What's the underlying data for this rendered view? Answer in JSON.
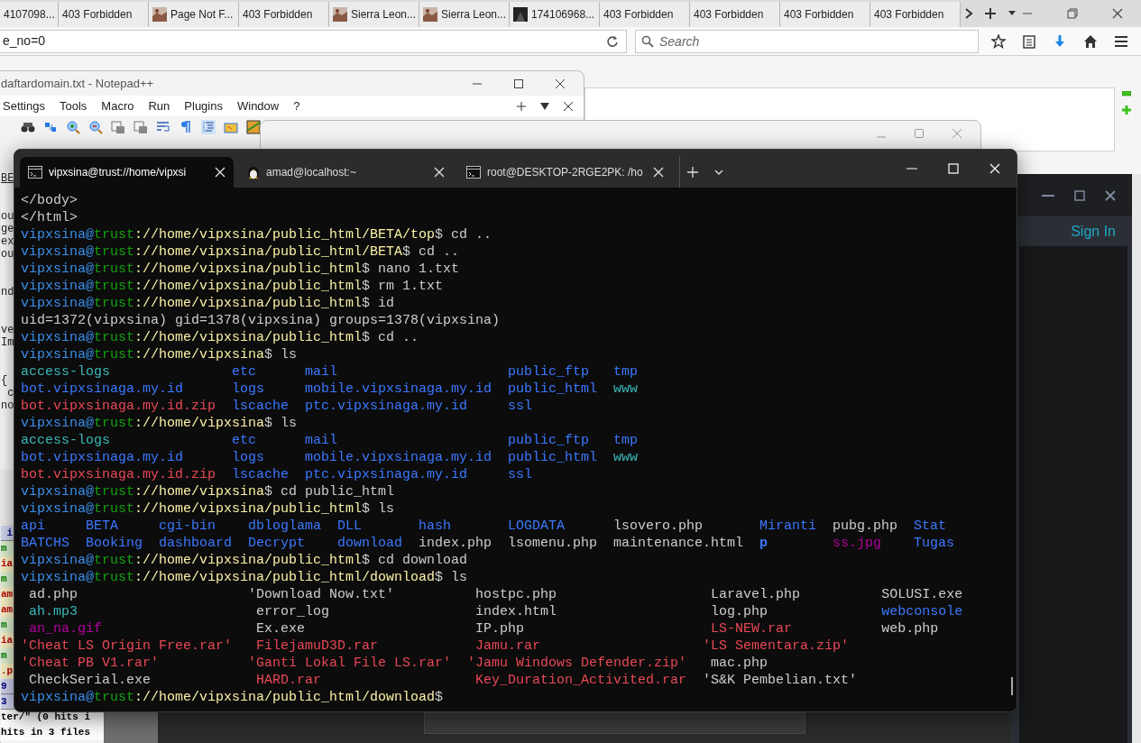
{
  "browser": {
    "tabs": [
      {
        "title": "4107098...",
        "kind": "plain",
        "selected": false
      },
      {
        "title": "403 Forbidden",
        "kind": "plain",
        "selected": false
      },
      {
        "title": "Page Not F...",
        "kind": "picture",
        "selected": false
      },
      {
        "title": "403 Forbidden",
        "kind": "plain",
        "selected": false
      },
      {
        "title": "Sierra Leon...",
        "kind": "picture",
        "selected": false
      },
      {
        "title": "Sierra Leon...",
        "kind": "picture",
        "selected": false
      },
      {
        "title": "174106968...",
        "kind": "dark",
        "selected": false
      },
      {
        "title": "403 Forbidden",
        "kind": "plain",
        "selected": false
      },
      {
        "title": "403 Forbidden",
        "kind": "plain",
        "selected": false
      },
      {
        "title": "403 Forbidden",
        "kind": "plain",
        "selected": false
      },
      {
        "title": "403 Forbidden",
        "kind": "plain",
        "selected": false
      }
    ],
    "url": "e_no=0",
    "search_placeholder": "Search"
  },
  "notepad": {
    "title": "daftardomain.txt - Notepad++",
    "menu": [
      "Settings",
      "Tools",
      "Macro",
      "Run",
      "Plugins",
      "Window",
      "?"
    ],
    "text_blocks": [
      [
        "BE"
      ],
      [
        "ou",
        "ge",
        "ex",
        "ou"
      ],
      [
        "nd"
      ],
      [
        "ve",
        "Im"
      ],
      [
        "{",
        " c",
        "no"
      ]
    ],
    "results": [
      {
        "text": " i",
        "kind": "header"
      },
      {
        "text": "m",
        "kind": "line"
      },
      {
        "text": "ia",
        "kind": "match"
      },
      {
        "text": "m",
        "kind": "line"
      },
      {
        "text": "am",
        "kind": "match"
      },
      {
        "text": "am",
        "kind": "match"
      },
      {
        "text": "m",
        "kind": "line"
      },
      {
        "text": "ia",
        "kind": "match"
      },
      {
        "text": "m",
        "kind": "line"
      },
      {
        "text": ".p",
        "kind": "match"
      },
      {
        "text": "9",
        "kind": "header"
      },
      {
        "text": "3",
        "kind": "header"
      },
      {
        "text": "ter/\" (0 hits i",
        "kind": "summary"
      },
      {
        "text": "hits in 3 files",
        "kind": "summary"
      }
    ]
  },
  "terminal": {
    "tabs": [
      {
        "title": "vipxsina@trust://home/vipxsi",
        "kind": "console",
        "selected": true
      },
      {
        "title": "amad@localhost:~",
        "kind": "penguin",
        "selected": false
      },
      {
        "title": "root@DESKTOP-2RGE2PK: /ho",
        "kind": "console",
        "selected": false
      }
    ],
    "lines": [
      {
        "kind": "text",
        "segments": [
          {
            "text": "</body>",
            "color": "#cccccc"
          }
        ]
      },
      {
        "kind": "text",
        "segments": [
          {
            "text": "</html>",
            "color": "#cccccc"
          }
        ]
      },
      {
        "kind": "text",
        "segments": [
          {
            "text": "vipxsina@",
            "color": "#3b8eea"
          },
          {
            "text": "trust",
            "color": "#13a10e"
          },
          {
            "text": "://home/vipxsina/public_html/BETA/top",
            "color": "#f9f1a5"
          },
          {
            "text": "$ cd ..",
            "color": "#cccccc"
          }
        ]
      },
      {
        "kind": "text",
        "segments": [
          {
            "text": "vipxsina@",
            "color": "#3b8eea"
          },
          {
            "text": "trust",
            "color": "#13a10e"
          },
          {
            "text": "://home/vipxsina/public_html/BETA",
            "color": "#f9f1a5"
          },
          {
            "text": "$ cd ..",
            "color": "#cccccc"
          }
        ]
      },
      {
        "kind": "text",
        "segments": [
          {
            "text": "vipxsina@",
            "color": "#3b8eea"
          },
          {
            "text": "trust",
            "color": "#13a10e"
          },
          {
            "text": "://home/vipxsina/public_html",
            "color": "#f9f1a5"
          },
          {
            "text": "$ nano 1.txt",
            "color": "#cccccc"
          }
        ]
      },
      {
        "kind": "text",
        "segments": [
          {
            "text": "vipxsina@",
            "color": "#3b8eea"
          },
          {
            "text": "trust",
            "color": "#13a10e"
          },
          {
            "text": "://home/vipxsina/public_html",
            "color": "#f9f1a5"
          },
          {
            "text": "$ rm 1.txt",
            "color": "#cccccc"
          }
        ]
      },
      {
        "kind": "text",
        "segments": [
          {
            "text": "vipxsina@",
            "color": "#3b8eea"
          },
          {
            "text": "trust",
            "color": "#13a10e"
          },
          {
            "text": "://home/vipxsina/public_html",
            "color": "#f9f1a5"
          },
          {
            "text": "$ id",
            "color": "#cccccc"
          }
        ]
      },
      {
        "kind": "text",
        "segments": [
          {
            "text": "uid=1372(vipxsina) gid=1378(vipxsina) groups=1378(vipxsina)",
            "color": "#cccccc"
          }
        ]
      },
      {
        "kind": "text",
        "segments": [
          {
            "text": "vipxsina@",
            "color": "#3b8eea"
          },
          {
            "text": "trust",
            "color": "#13a10e"
          },
          {
            "text": "://home/vipxsina/public_html",
            "color": "#f9f1a5"
          },
          {
            "text": "$ cd ..",
            "color": "#cccccc"
          }
        ]
      },
      {
        "kind": "text",
        "segments": [
          {
            "text": "vipxsina@",
            "color": "#3b8eea"
          },
          {
            "text": "trust",
            "color": "#13a10e"
          },
          {
            "text": "://home/vipxsina",
            "color": "#f9f1a5"
          },
          {
            "text": "$ ls",
            "color": "#cccccc"
          }
        ]
      },
      {
        "kind": "listing",
        "rows": [
          [
            {
              "text": "access-logs",
              "color": "#3ab7b7"
            },
            {
              "text": "etc",
              "color": "#3b78ff"
            },
            {
              "text": "mail",
              "color": "#3b78ff"
            },
            {
              "text": "public_ftp",
              "color": "#3b78ff"
            },
            {
              "text": "tmp",
              "color": "#3b78ff"
            }
          ],
          [
            {
              "text": "bot.vipxsinaga.my.id",
              "color": "#3b78ff"
            },
            {
              "text": "logs",
              "color": "#3b78ff"
            },
            {
              "text": "mobile.vipxsinaga.my.id",
              "color": "#3b78ff"
            },
            {
              "text": "public_html",
              "color": "#3b78ff"
            },
            {
              "text": "www",
              "color": "#3ab7b7"
            }
          ],
          [
            {
              "text": "bot.vipxsinaga.my.id.zip",
              "color": "#e74856"
            },
            {
              "text": "lscache",
              "color": "#3b78ff"
            },
            {
              "text": "ptc.vipxsinaga.my.id",
              "color": "#3b78ff"
            },
            {
              "text": "ssl",
              "color": "#3b78ff"
            }
          ]
        ]
      },
      {
        "kind": "text",
        "segments": [
          {
            "text": "vipxsina@",
            "color": "#3b8eea"
          },
          {
            "text": "trust",
            "color": "#13a10e"
          },
          {
            "text": "://home/vipxsina",
            "color": "#f9f1a5"
          },
          {
            "text": "$ ls",
            "color": "#cccccc"
          }
        ]
      },
      {
        "kind": "listing",
        "rows": [
          [
            {
              "text": "access-logs",
              "color": "#3ab7b7"
            },
            {
              "text": "etc",
              "color": "#3b78ff"
            },
            {
              "text": "mail",
              "color": "#3b78ff"
            },
            {
              "text": "public_ftp",
              "color": "#3b78ff"
            },
            {
              "text": "tmp",
              "color": "#3b78ff"
            }
          ],
          [
            {
              "text": "bot.vipxsinaga.my.id",
              "color": "#3b78ff"
            },
            {
              "text": "logs",
              "color": "#3b78ff"
            },
            {
              "text": "mobile.vipxsinaga.my.id",
              "color": "#3b78ff"
            },
            {
              "text": "public_html",
              "color": "#3b78ff"
            },
            {
              "text": "www",
              "color": "#3ab7b7"
            }
          ],
          [
            {
              "text": "bot.vipxsinaga.my.id.zip",
              "color": "#e74856"
            },
            {
              "text": "lscache",
              "color": "#3b78ff"
            },
            {
              "text": "ptc.vipxsinaga.my.id",
              "color": "#3b78ff"
            },
            {
              "text": "ssl",
              "color": "#3b78ff"
            }
          ]
        ]
      },
      {
        "kind": "text",
        "segments": [
          {
            "text": "vipxsina@",
            "color": "#3b8eea"
          },
          {
            "text": "trust",
            "color": "#13a10e"
          },
          {
            "text": "://home/vipxsina",
            "color": "#f9f1a5"
          },
          {
            "text": "$ cd public_html",
            "color": "#cccccc"
          }
        ]
      },
      {
        "kind": "text",
        "segments": [
          {
            "text": "vipxsina@",
            "color": "#3b8eea"
          },
          {
            "text": "trust",
            "color": "#13a10e"
          },
          {
            "text": "://home/vipxsina/public_html",
            "color": "#f9f1a5"
          },
          {
            "text": "$ ls",
            "color": "#cccccc"
          }
        ]
      },
      {
        "kind": "listing",
        "rows": [
          [
            {
              "text": "api",
              "color": "#3b78ff"
            },
            {
              "text": "BETA",
              "color": "#3b78ff"
            },
            {
              "text": "cgi-bin",
              "color": "#3b78ff"
            },
            {
              "text": "dbloglama",
              "color": "#3b78ff"
            },
            {
              "text": "DLL",
              "color": "#3b78ff"
            },
            {
              "text": "hash",
              "color": "#3b78ff"
            },
            {
              "text": "LOGDATA",
              "color": "#3b78ff"
            },
            {
              "text": "lsovero.php",
              "color": "#cccccc"
            },
            {
              "text": "Miranti",
              "color": "#3b78ff"
            },
            {
              "text": "pubg.php",
              "color": "#cccccc"
            },
            {
              "text": "Stat",
              "color": "#3b78ff"
            }
          ],
          [
            {
              "text": "BATCHS",
              "color": "#3b78ff"
            },
            {
              "text": "Booking",
              "color": "#3b78ff"
            },
            {
              "text": "dashboard",
              "color": "#3b78ff"
            },
            {
              "text": "Decrypt",
              "color": "#3b78ff"
            },
            {
              "text": "download",
              "color": "#3b78ff"
            },
            {
              "text": "index.php",
              "color": "#cccccc"
            },
            {
              "text": "lsomenu.php",
              "color": "#cccccc"
            },
            {
              "text": "maintenance.html",
              "color": "#cccccc"
            },
            {
              "text": "p",
              "color": "#3b78ff"
            },
            {
              "text": "ss.jpg",
              "color": "#b4009e"
            },
            {
              "text": "Tugas",
              "color": "#3b78ff"
            }
          ]
        ]
      },
      {
        "kind": "text",
        "segments": [
          {
            "text": "vipxsina@",
            "color": "#3b8eea"
          },
          {
            "text": "trust",
            "color": "#13a10e"
          },
          {
            "text": "://home/vipxsina/public_html",
            "color": "#f9f1a5"
          },
          {
            "text": "$ cd download",
            "color": "#cccccc"
          }
        ]
      },
      {
        "kind": "text",
        "segments": [
          {
            "text": "vipxsina@",
            "color": "#3b8eea"
          },
          {
            "text": "trust",
            "color": "#13a10e"
          },
          {
            "text": "://home/vipxsina/public_html/download",
            "color": "#f9f1a5"
          },
          {
            "text": "$ ls",
            "color": "#cccccc"
          }
        ]
      },
      {
        "kind": "listing",
        "rows": [
          [
            {
              "text": " ad.php",
              "color": "#cccccc"
            },
            {
              "text": "'Download Now.txt'",
              "color": "#cccccc"
            },
            {
              "text": " hostpc.php",
              "color": "#cccccc"
            },
            {
              "text": " Laravel.php",
              "color": "#cccccc"
            },
            {
              "text": "SOLUSI.exe",
              "color": "#cccccc"
            }
          ],
          [
            {
              "text": " ah.mp3",
              "color": "#3ab7b7"
            },
            {
              "text": " error_log",
              "color": "#cccccc"
            },
            {
              "text": " index.html",
              "color": "#cccccc"
            },
            {
              "text": " log.php",
              "color": "#cccccc"
            },
            {
              "text": "webconsole",
              "color": "#3b78ff"
            }
          ],
          [
            {
              "text": " an_na.gif",
              "color": "#b4009e"
            },
            {
              "text": " Ex.exe",
              "color": "#cccccc"
            },
            {
              "text": " IP.php",
              "color": "#cccccc"
            },
            {
              "text": " LS-NEW.rar",
              "color": "#e74856"
            },
            {
              "text": "web.php",
              "color": "#cccccc"
            }
          ],
          [
            {
              "text": "'Cheat LS Origin Free.rar'",
              "color": "#e74856"
            },
            {
              "text": " FilejamuD3D.rar",
              "color": "#e74856"
            },
            {
              "text": " Jamu.rar",
              "color": "#e74856"
            },
            {
              "text": "'LS Sementara.zip'",
              "color": "#e74856"
            }
          ],
          [
            {
              "text": "'Cheat PB V1.rar'",
              "color": "#e74856"
            },
            {
              "text": "'Ganti Lokal File LS.rar'",
              "color": "#e74856"
            },
            {
              "text": "'Jamu Windows Defender.zip'",
              "color": "#e74856"
            },
            {
              "text": " mac.php",
              "color": "#cccccc"
            }
          ],
          [
            {
              "text": " CheckSerial.exe",
              "color": "#cccccc"
            },
            {
              "text": " HARD.rar",
              "color": "#e74856"
            },
            {
              "text": " Key_Duration_Activited.rar",
              "color": "#e74856"
            },
            {
              "text": "'S&K Pembelian.txt'",
              "color": "#cccccc"
            }
          ]
        ]
      },
      {
        "kind": "text",
        "segments": [
          {
            "text": "vipxsina@",
            "color": "#3b8eea"
          },
          {
            "text": "trust",
            "color": "#13a10e"
          },
          {
            "text": "://home/vipxsina/public_html/download",
            "color": "#f9f1a5"
          },
          {
            "text": "$",
            "color": "#cccccc"
          }
        ]
      }
    ]
  },
  "side_window": {
    "link": "Sign In"
  }
}
